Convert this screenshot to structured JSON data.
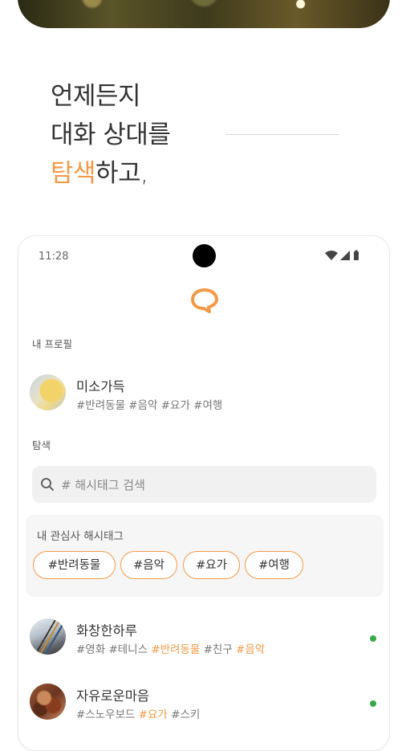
{
  "headline": {
    "line1": "언제든지",
    "line2": "대화 상대를",
    "line3_accent": "탐색",
    "line3_rest": "하고,"
  },
  "status_bar": {
    "time": "11:28"
  },
  "my_profile": {
    "section_label": "내 프로필",
    "name": "미소가득",
    "tags": "#반려동물 #음악 #요가 #여행"
  },
  "explore": {
    "section_label": "탐색",
    "search_placeholder": "# 해시태그 검색"
  },
  "interests": {
    "title": "내 관심사 해시태그",
    "chips": [
      "#반려동물",
      "#음악",
      "#요가",
      "#여행"
    ]
  },
  "users": [
    {
      "name": "화창한하루",
      "tags": [
        {
          "text": "#영화 #테니스 ",
          "highlight": false
        },
        {
          "text": "#반려동물",
          "highlight": true
        },
        {
          "text": " #친구 ",
          "highlight": false
        },
        {
          "text": "#음악",
          "highlight": true
        }
      ],
      "online": true
    },
    {
      "name": "자유로운마음",
      "tags": [
        {
          "text": "#스노우보드 ",
          "highlight": false
        },
        {
          "text": "#요가",
          "highlight": true
        },
        {
          "text": " #스키",
          "highlight": false
        }
      ],
      "online": true
    }
  ],
  "colors": {
    "accent": "#f39a47",
    "online": "#3aa84a",
    "surface": "#f6f6f6"
  },
  "icons": [
    "wifi-icon",
    "signal-icon",
    "battery-icon",
    "chat-bubble-logo-icon",
    "search-icon"
  ]
}
